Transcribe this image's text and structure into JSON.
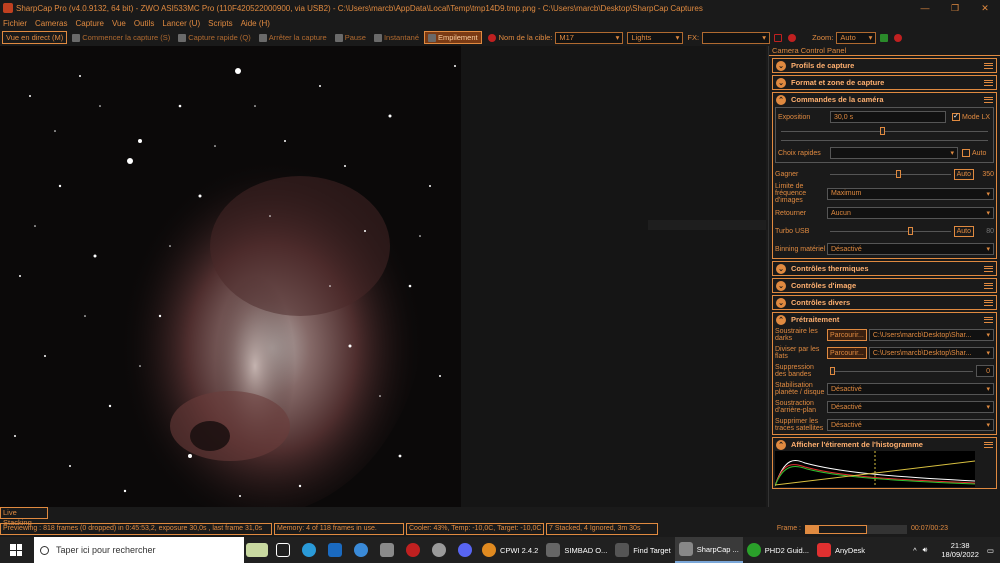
{
  "window": {
    "title": "SharpCap Pro (v4.0.9132, 64 bit) - ZWO ASI533MC Pro (110F420522000900, via USB2) - C:\\Users\\marcb\\AppData\\Local\\Temp\\tmp14D9.tmp.png - C:\\Users\\marcb\\Desktop\\SharpCap Captures",
    "min": "—",
    "max": "❐",
    "close": "✕"
  },
  "menu": [
    "Fichier",
    "Cameras",
    "Capture",
    "Vue",
    "Outils",
    "Lancer (U)",
    "Scripts",
    "Aide (H)"
  ],
  "toolbar": {
    "live": "Vue en direct (M)",
    "start_capture": "Commencer la capture (S)",
    "quick_capture": "Capture rapide (Q)",
    "stop_capture": "Arrêter la capture",
    "pause": "Pause",
    "snapshot": "Instantané",
    "stacking": "Empilement",
    "target_label": "Nom de la cible:",
    "target_value": "M17",
    "frame_type": "Lights",
    "fx_label": "FX:",
    "fx_value": "",
    "zoom_label": "Zoom:",
    "zoom_value": "Auto"
  },
  "panel": {
    "title": "Camera Control Panel",
    "sections": {
      "profiles": "Profils de capture",
      "format": "Format et zone de capture",
      "camera": "Commandes de la caméra",
      "thermal": "Contrôles thermiques",
      "image": "Contrôles d'image",
      "misc": "Contrôles divers",
      "preprocessing": "Prétraitement",
      "histogram": "Afficher l'étirement de l'histogramme"
    },
    "camera": {
      "exposure_label": "Exposition",
      "exposure_value": "30,0 s",
      "lx_mode": "Mode LX",
      "quick_choice": "Choix rapides",
      "quick_auto": "Auto",
      "gain_label": "Gagner",
      "gain_auto": "Auto",
      "gain_value": "350",
      "framerate_label": "Limite de fréquence d'images",
      "framerate_value": "Maximum",
      "flip_label": "Retourner",
      "flip_value": "Aucun",
      "turbo_label": "Turbo USB",
      "turbo_auto": "Auto",
      "turbo_value": "80",
      "binning_label": "Binning matériel",
      "binning_value": "Désactivé"
    },
    "pre": {
      "darks_label": "Soustraire les darks",
      "darks_btn": "Parcourir...",
      "darks_path": "C:\\Users\\marcb\\Desktop\\Shar...",
      "flats_label": "Diviser par les flats",
      "flats_btn": "Parcourir...",
      "flats_path": "C:\\Users\\marcb\\Desktop\\Shar...",
      "banding_label": "Suppression des bandes",
      "banding_value": "0",
      "stab_label": "Stabilisation planète / disque",
      "stab_value": "Désactivé",
      "bg_label": "Soustraction d'arrière-plan",
      "bg_value": "Désactivé",
      "sat_label": "Supprimer les traces satellites",
      "sat_value": "Désactivé"
    }
  },
  "live_stacking": "Live Stacking",
  "status": {
    "preview": "Previewing : 818 frames (0 dropped) in 0:45:53,2, exposure 30,0s , last frame 31,0s",
    "memory": "Memory: 4 of 118 frames in use.",
    "cooler": "Cooler: 43%, Temp: -10,0C, Target: -10,0C",
    "stacked": "7 Stacked, 4 Ignored, 3m 30s",
    "frame_label": "Frame :",
    "frame_time": "00:07/00:23",
    "frame_progress": 0.22
  },
  "taskbar": {
    "search_placeholder": "Taper ici pour rechercher",
    "apps": [
      "CPWI 2.4.2",
      "SIMBAD O...",
      "Find Target",
      "SharpCap ...",
      "PHD2 Guid...",
      "AnyDesk"
    ],
    "time": "21:38",
    "date": "18/09/2022"
  }
}
